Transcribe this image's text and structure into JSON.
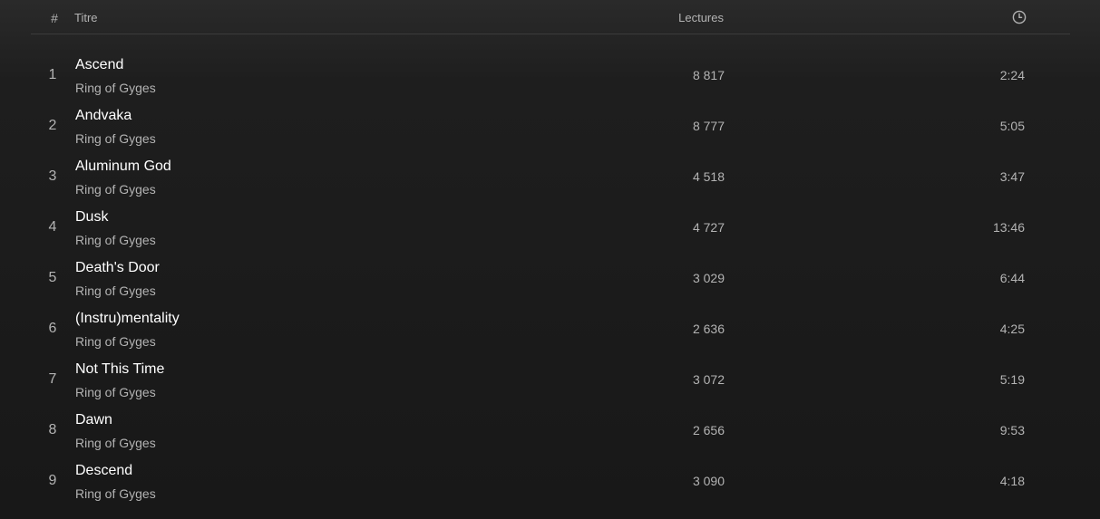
{
  "header": {
    "num_label": "#",
    "title_label": "Titre",
    "plays_label": "Lectures",
    "duration_icon": "clock-icon"
  },
  "tracks": [
    {
      "num": "1",
      "title": "Ascend",
      "artist": "Ring of Gyges",
      "plays": "8 817",
      "duration": "2:24"
    },
    {
      "num": "2",
      "title": "Andvaka",
      "artist": "Ring of Gyges",
      "plays": "8 777",
      "duration": "5:05"
    },
    {
      "num": "3",
      "title": "Aluminum God",
      "artist": "Ring of Gyges",
      "plays": "4 518",
      "duration": "3:47"
    },
    {
      "num": "4",
      "title": "Dusk",
      "artist": "Ring of Gyges",
      "plays": "4 727",
      "duration": "13:46"
    },
    {
      "num": "5",
      "title": "Death's Door",
      "artist": "Ring of Gyges",
      "plays": "3 029",
      "duration": "6:44"
    },
    {
      "num": "6",
      "title": "(Instru)mentality",
      "artist": "Ring of Gyges",
      "plays": "2 636",
      "duration": "4:25"
    },
    {
      "num": "7",
      "title": "Not This Time",
      "artist": "Ring of Gyges",
      "plays": "3 072",
      "duration": "5:19"
    },
    {
      "num": "8",
      "title": "Dawn",
      "artist": "Ring of Gyges",
      "plays": "2 656",
      "duration": "9:53"
    },
    {
      "num": "9",
      "title": "Descend",
      "artist": "Ring of Gyges",
      "plays": "3 090",
      "duration": "4:18"
    }
  ]
}
